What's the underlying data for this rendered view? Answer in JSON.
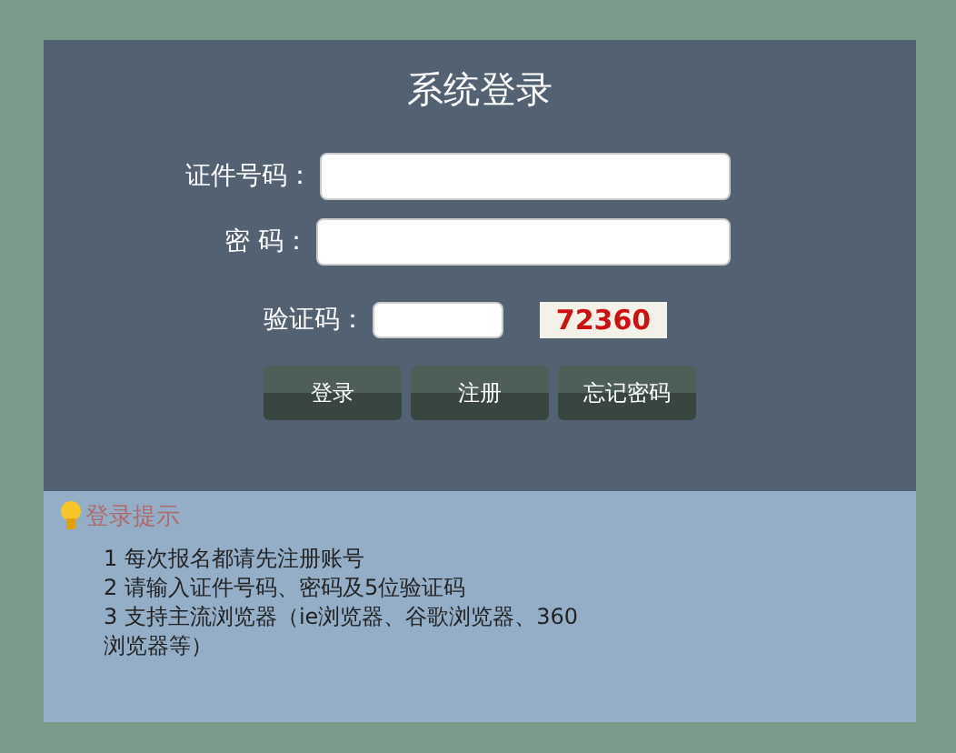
{
  "title": "系统登录",
  "fields": [
    {
      "label": "证件号码：",
      "kind": "text"
    },
    {
      "label": "密 码：",
      "kind": "password"
    },
    {
      "label": "验证码：",
      "kind": "captcha",
      "captcha": "72360"
    }
  ],
  "buttons": [
    "登录",
    "注册",
    "忘记密码"
  ],
  "tips": {
    "heading": "登录提示",
    "items": [
      "1 每次报名都请先注册账号",
      "2 请输入证件号码、密码及5位验证码",
      "3 支持主流浏览器（ie浏览器、谷歌浏览器、360浏览器等）"
    ]
  }
}
